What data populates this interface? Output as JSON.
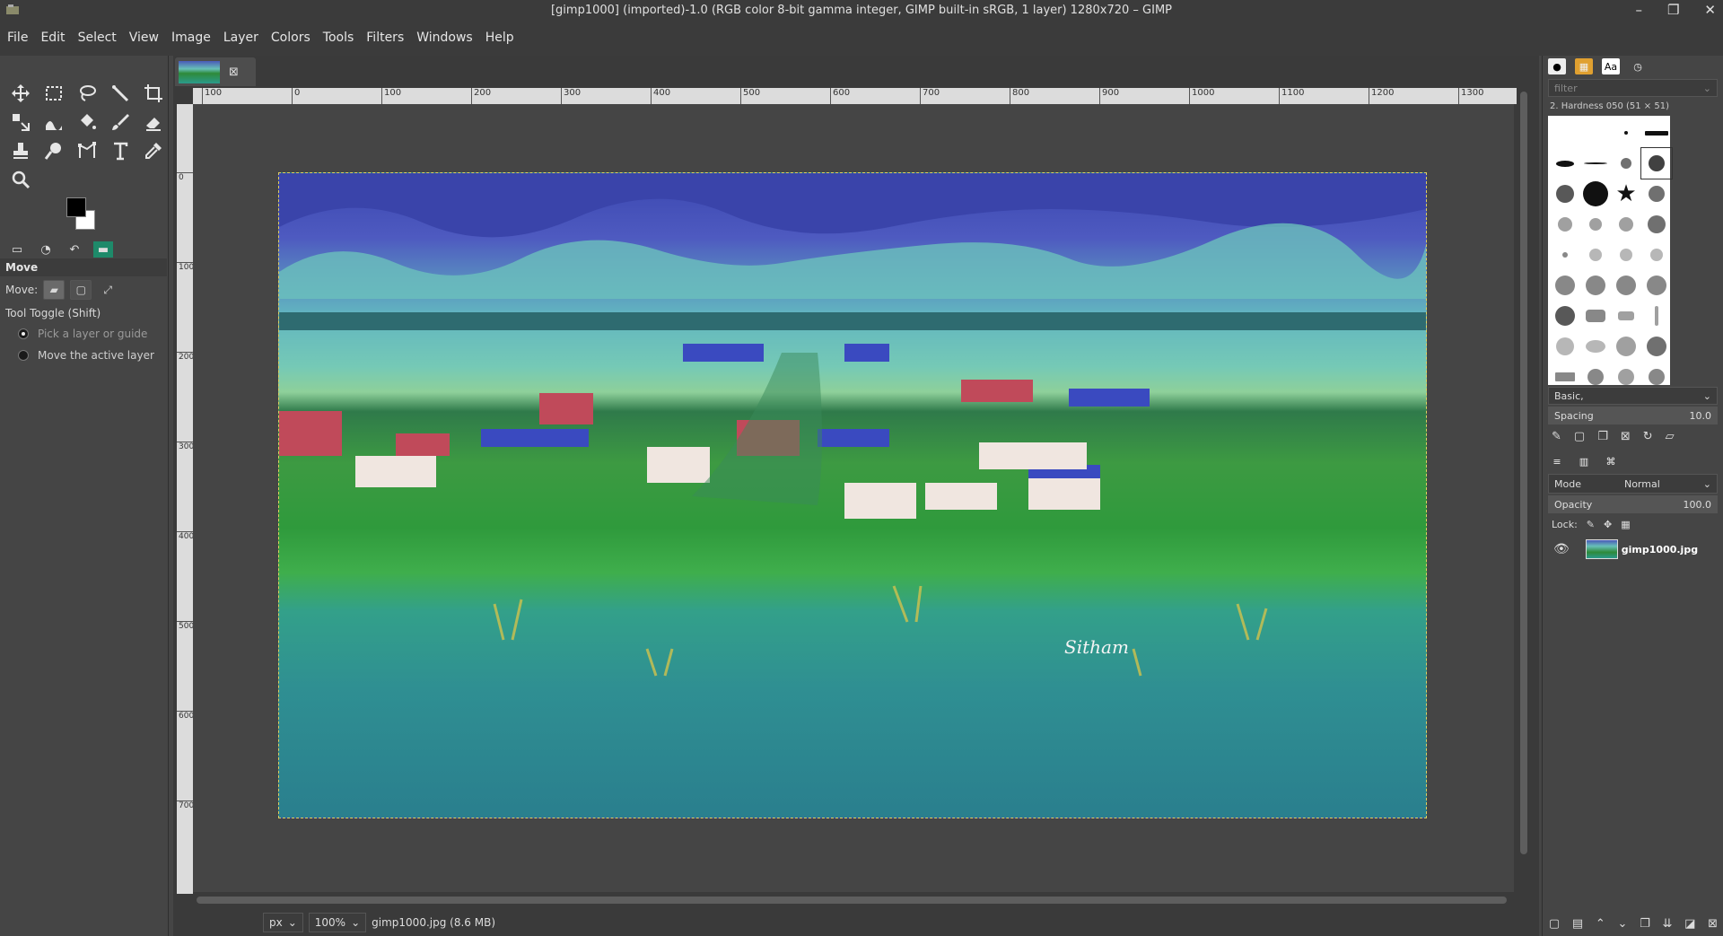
{
  "window": {
    "title": "[gimp1000] (imported)-1.0 (RGB color 8-bit gamma integer, GIMP built-in sRGB, 1 layer) 1280x720 – GIMP",
    "minimize": "–",
    "maximize": "❐",
    "close": "✕"
  },
  "menu": [
    "File",
    "Edit",
    "Select",
    "View",
    "Image",
    "Layer",
    "Colors",
    "Tools",
    "Filters",
    "Windows",
    "Help"
  ],
  "tool_options": {
    "header": "Move",
    "move_label": "Move:",
    "toggle_label": "Tool Toggle  (Shift)",
    "option_1": "Pick a layer or guide",
    "option_2": "Move the active layer"
  },
  "ruler_labels": [
    "100",
    "0",
    "100",
    "200",
    "300",
    "400",
    "500",
    "600",
    "700",
    "800",
    "900",
    "1000",
    "1100",
    "1200",
    "1300"
  ],
  "vruler_labels": [
    "0",
    "100",
    "200",
    "300",
    "400",
    "500",
    "600",
    "700"
  ],
  "status": {
    "unit": "px",
    "zoom": "100%",
    "file_info": "gimp1000.jpg (8.6 MB)"
  },
  "brushes": {
    "filter_placeholder": "filter",
    "selected": "2. Hardness 050 (51 × 51)",
    "preset": "Basic,",
    "spacing_label": "Spacing",
    "spacing_value": "10.0"
  },
  "layers": {
    "mode_label": "Mode",
    "mode_value": "Normal",
    "opacity_label": "Opacity",
    "opacity_value": "100.0",
    "lock_label": "Lock:",
    "layer_name": "gimp1000.jpg"
  },
  "colors": {
    "fg": "#000000",
    "bg": "#ffffff"
  }
}
